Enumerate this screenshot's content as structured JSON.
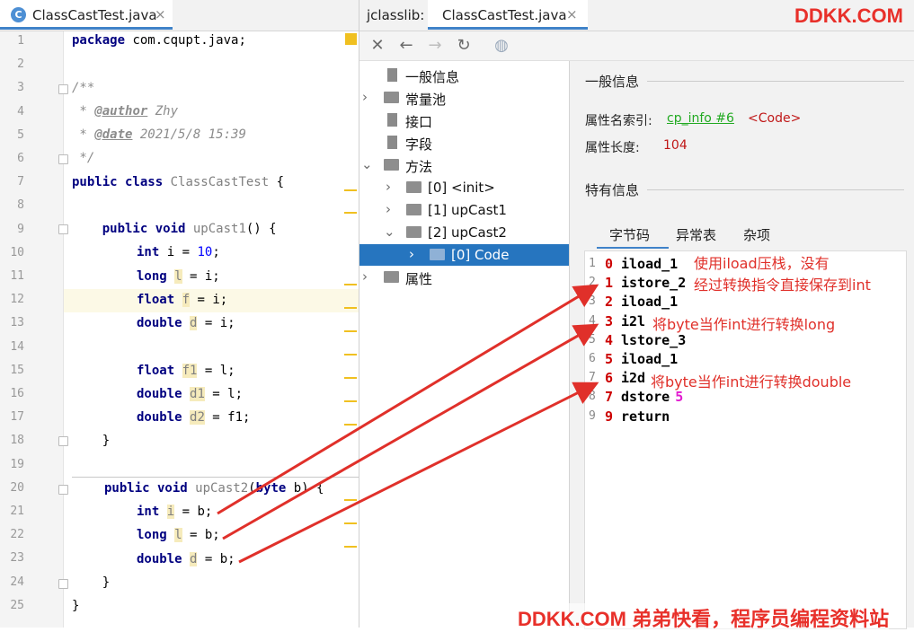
{
  "editor_tab": {
    "icon_letter": "C",
    "filename": "ClassCastTest.java",
    "close": "×"
  },
  "jclasslib_tab": {
    "prefix": "jclasslib:",
    "filename": "ClassCastTest.java",
    "close": "×"
  },
  "watermark": {
    "top": "DDKK.COM",
    "bottom": "DDKK.COM 弟弟快看，程序员编程资料站"
  },
  "code": {
    "line_numbers": [
      "1",
      "2",
      "3",
      "4",
      "5",
      "6",
      "7",
      "8",
      "9",
      "10",
      "11",
      "12",
      "13",
      "14",
      "15",
      "16",
      "17",
      "18",
      "19",
      "20",
      "21",
      "22",
      "23",
      "24",
      "25"
    ],
    "l1_kw": "package",
    "l1_rest": " com.cqupt.java;",
    "l3": "/**",
    "l4_pre": " * ",
    "l4_tag": "@author",
    "l4_val": " Zhy",
    "l5_pre": " * ",
    "l5_tag": "@date",
    "l5_val": " 2021/5/8 15:39",
    "l6": " */",
    "l7_kw": "public class",
    "l7_name": " ClassCastTest",
    "l7_rest": " {",
    "l9_indent": "    ",
    "l9_kw": "public void",
    "l9_name": " upCast1",
    "l9_rest": "() {",
    "l10_kw": "int",
    "l10_rest1": " i = ",
    "l10_num": "10",
    "l10_rest2": ";",
    "l11_kw": "long",
    "l11_var": "l",
    "l11_rest": " = i;",
    "l12_kw": "float",
    "l12_var": "f",
    "l12_rest": " = i;",
    "l13_kw": "double",
    "l13_var": "d",
    "l13_rest": " = i;",
    "l15_kw": "float",
    "l15_var": "f1",
    "l15_rest": " = l;",
    "l16_kw": "double",
    "l16_var": "d1",
    "l16_rest": " = l;",
    "l17_kw": "double",
    "l17_var": "d2",
    "l17_rest": " = f1;",
    "l18": "    }",
    "l20_kw": "public void",
    "l20_name": " upCast2",
    "l20_p1": "(",
    "l20_kw2": "byte",
    "l20_p2": " b) {",
    "l21_kw": "int",
    "l21_var": "i",
    "l21_rest": " = b;",
    "l22_kw": "long",
    "l22_var": "l",
    "l22_rest": " = b;",
    "l23_kw": "double",
    "l23_var": "d",
    "l23_rest": " = b;",
    "l24": "    }",
    "l25": "}"
  },
  "toolbar": {
    "close": "✕",
    "back": "←",
    "forward": "→",
    "refresh": "↻",
    "browser": "◍"
  },
  "tree": {
    "general": "一般信息",
    "constant_pool": "常量池",
    "interfaces": "接口",
    "fields": "字段",
    "methods": "方法",
    "m0": "[0] <init>",
    "m1": "[1] upCast1",
    "m2": "[2] upCast2",
    "m2_code": "[0] Code",
    "attributes": "属性"
  },
  "info": {
    "general_title": "一般信息",
    "name_index_label": "属性名索引:",
    "name_index_link": "cp_info #6",
    "name_index_value": "<Code>",
    "length_label": "属性长度:",
    "length_value": "104",
    "specific_title": "特有信息",
    "tabs": [
      "字节码",
      "异常表",
      "杂项"
    ]
  },
  "bytecode": [
    {
      "line": "1",
      "index": "0",
      "op": "iload_1",
      "arg": ""
    },
    {
      "line": "2",
      "index": "1",
      "op": "istore_2",
      "arg": ""
    },
    {
      "line": "3",
      "index": "2",
      "op": "iload_1",
      "arg": ""
    },
    {
      "line": "4",
      "index": "3",
      "op": "i2l",
      "arg": ""
    },
    {
      "line": "5",
      "index": "4",
      "op": "lstore_3",
      "arg": ""
    },
    {
      "line": "6",
      "index": "5",
      "op": "iload_1",
      "arg": ""
    },
    {
      "line": "7",
      "index": "6",
      "op": "i2d",
      "arg": ""
    },
    {
      "line": "8",
      "index": "7",
      "op": "dstore",
      "arg": "5"
    },
    {
      "line": "9",
      "index": "9",
      "op": "return",
      "arg": ""
    }
  ],
  "annotations": {
    "a1": "使用iload压栈，没有",
    "a2": "经过转换指令直接保存到int",
    "a3": "将byte当作int进行转换long",
    "a4": "将byte当作int进行转换double"
  },
  "colors": {
    "accent": "#4083c9",
    "selection": "#2675bf",
    "annotation": "#e0302a",
    "keyword": "#000080"
  }
}
